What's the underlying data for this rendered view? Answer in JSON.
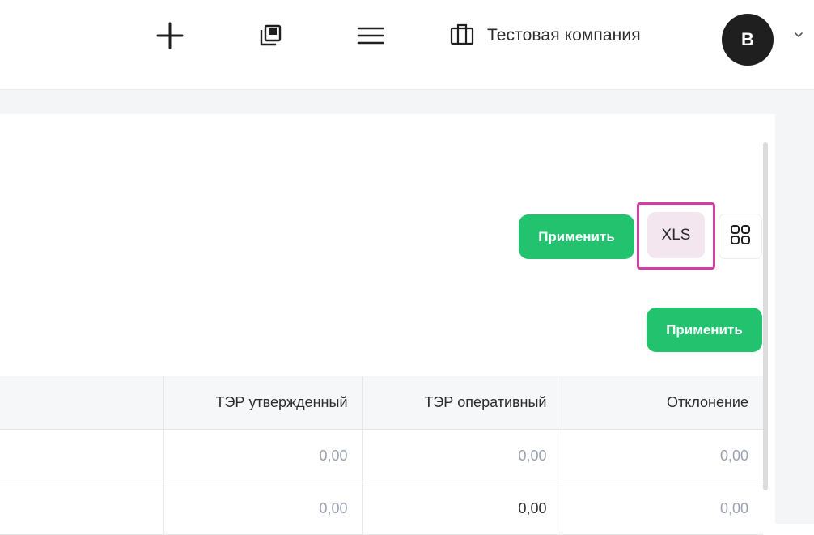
{
  "header": {
    "company_name": "Тестовая компания",
    "avatar_letter": "B",
    "icons": [
      "plus-icon",
      "copy-icon",
      "menu-icon",
      "briefcase-icon",
      "chevron-down-icon"
    ]
  },
  "toolbar": {
    "apply_label": "Применить",
    "xls_label": "XLS",
    "apply_label_2": "Применить"
  },
  "table": {
    "columns": [
      "",
      "ТЭР утвержденный",
      "ТЭР оперативный",
      "Отклонение"
    ],
    "rows": [
      [
        "",
        "0,00",
        "0,00",
        "0,00"
      ],
      [
        "",
        "0,00",
        "0,00",
        "0,00"
      ]
    ]
  },
  "colors": {
    "accent_green": "#22c26e",
    "highlight_pink": "#d63ea6"
  }
}
